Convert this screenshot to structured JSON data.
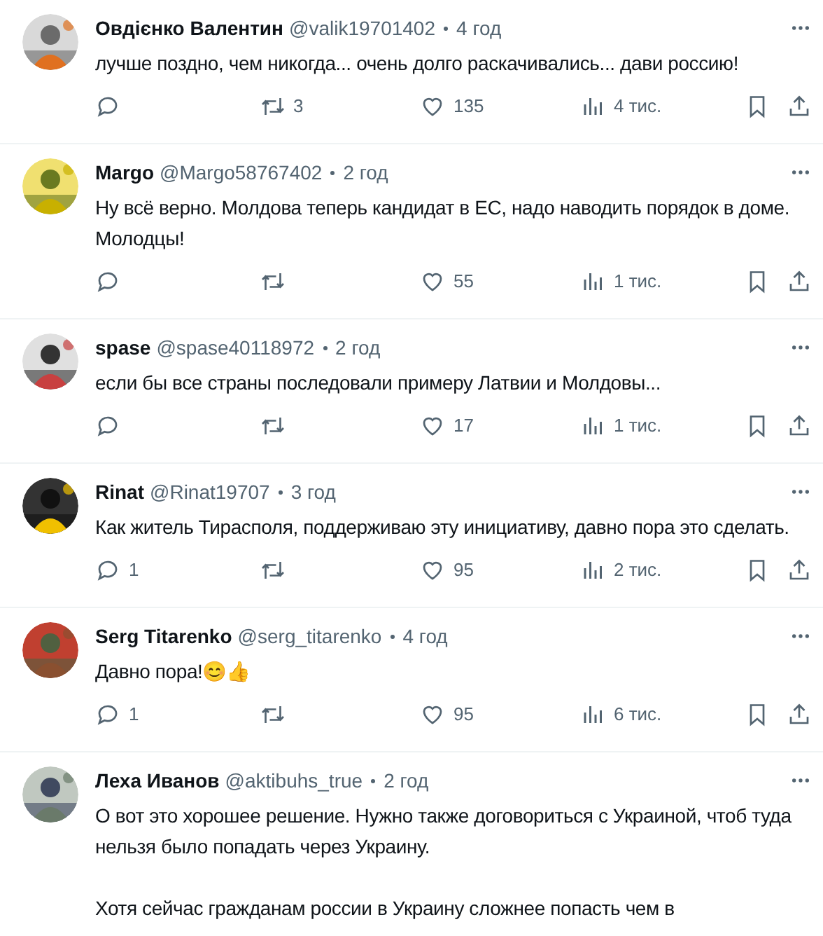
{
  "replies": [
    {
      "name": "Овдієнко Валентин",
      "handle": "@valik19701402",
      "time": "4 год",
      "paragraphs": [
        "лучше поздно, чем никогда... очень долго раскачивались... дави россию!"
      ],
      "retweets": "3",
      "likes": "135",
      "views": "4 тис."
    },
    {
      "name": "Margo",
      "handle": "@Margo58767402",
      "time": "2 год",
      "paragraphs": [
        "Ну всё верно. Молдова теперь кандидат в ЕС, надо наводить порядок в доме. Молодцы!"
      ],
      "likes": "55",
      "views": "1 тис."
    },
    {
      "name": "spase",
      "handle": "@spase40118972",
      "time": "2 год",
      "paragraphs": [
        "если бы все страны последовали примеру Латвии и Молдовы..."
      ],
      "likes": "17",
      "views": "1 тис."
    },
    {
      "name": "Rinat",
      "handle": "@Rinat19707",
      "time": "3 год",
      "paragraphs": [
        "Как житель Тирасполя, поддерживаю эту инициативу, давно пора это сделать."
      ],
      "replies": "1",
      "likes": "95",
      "views": "2 тис."
    },
    {
      "name": "Serg Titarenko",
      "handle": "@serg_titarenko",
      "time": "4 год",
      "paragraphs": [
        "Давно пора!😊👍"
      ],
      "replies": "1",
      "likes": "95",
      "views": "6 тис."
    },
    {
      "name": "Леха Иванов",
      "handle": "@aktibuhs_true",
      "time": "2 год",
      "paragraphs": [
        "О вот это хорошее решение. Нужно также договориться с Украиной, чтоб туда нельзя было попадать через Украину.",
        "Хотя сейчас гражданам россии в Украину сложнее попасть чем в"
      ]
    }
  ]
}
